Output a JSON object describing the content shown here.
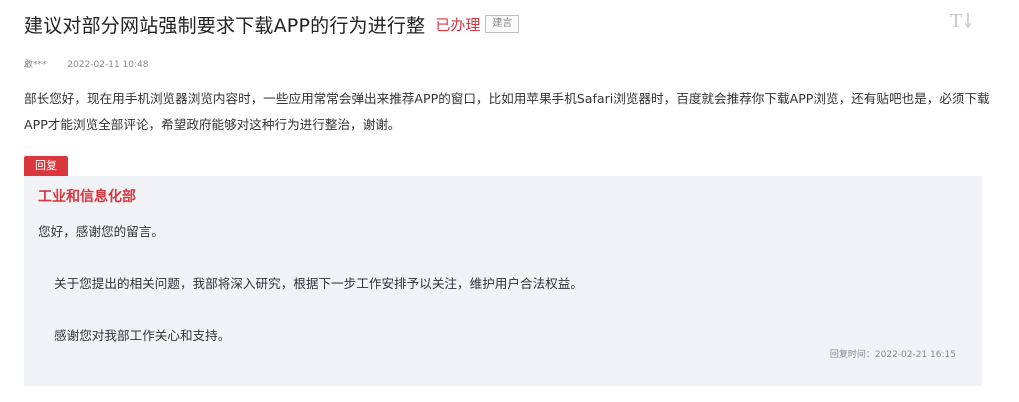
{
  "message": {
    "title": "建议对部分网站强制要求下载APP的行为进行整",
    "status": "已办理",
    "category_tag": "建言",
    "author": "敢***",
    "date": "2022-02-11 10:48",
    "body": "部长您好，现在用手机浏览器浏览内容时，一些应用常常会弹出来推荐APP的窗口，比如用苹果手机Safari浏览器时，百度就会推荐你下载APP浏览，还有贴吧也是，必须下载APP才能浏览全部评论，希望政府能够对这种行为进行整治，谢谢。"
  },
  "font_toggle": {
    "label": "T",
    "icon": "font-size-toggle-icon"
  },
  "reply": {
    "tag_label": "回复",
    "department": "工业和信息化部",
    "greeting": "您好，感谢您的留言。",
    "paragraphs": [
      "关于您提出的相关问题，我部将深入研究，根据下一步工作安排予以关注，维护用户合法权益。",
      "感谢您对我部工作关心和支持。"
    ],
    "time": "回复时间：2022-02-21 16:15"
  },
  "colors": {
    "accent_red": "#d9363e",
    "reply_background": "#f1f2f5",
    "muted_text": "#8a8a8a"
  }
}
